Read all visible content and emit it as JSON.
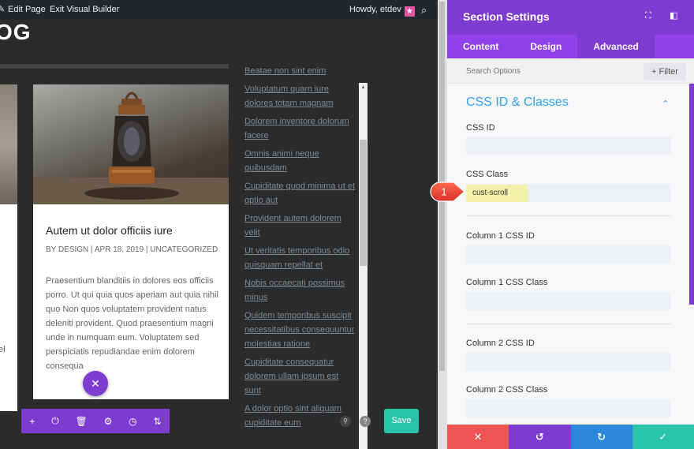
{
  "adminbar": {
    "edit_page": "Edit Page",
    "exit_vb": "Exit Visual Builder",
    "howdy": "Howdy, etdev"
  },
  "canvas": {
    "heading": "OG",
    "post": {
      "title": "Autem ut dolor officiis iure",
      "meta": "BY DESIGN | APR 18, 2019 | UNCATEGORIZED",
      "excerpt": "Praesentium blanditiis in dolores eos officiis porro. Ut qui quia quos aperiam aut quia nihil quo Non quos voluptatem provident natus deleniti provident. Quod praesentium magni unde in numquam eum. Voluptatem sed perspiciatis repudiandae enim dolorem consequa"
    },
    "left_card_text": "el",
    "links": [
      "Beatae non sint enim",
      "Voluptatum quam iure dolores totam magnam",
      "Dolorem inventore dolorum facere",
      "Omnis animi neque quibusdam",
      "Cupiditate quod minima ut et optio aut",
      "Provident autem dolorem velit",
      "Ut veritatis temporibus odio quisquam repellat et",
      "Nobis occaecati possimus minus",
      "Quidem temporibus suscipit necessitatibus consequuntur molestias ratione",
      "Cupiditate consequatur dolorem ullam ipsum est sunt",
      "A dolor optio sint aliquam cupiditate eum"
    ],
    "save_label": "Save"
  },
  "panel": {
    "title": "Section Settings",
    "tabs": [
      "Content",
      "Design",
      "Advanced"
    ],
    "active_tab": "Advanced",
    "search_placeholder": "Search Options",
    "filter_label": "+ Filter",
    "section_title": "CSS ID & Classes",
    "fields": {
      "css_id": "CSS ID",
      "css_class": "CSS Class",
      "css_class_value": "cust-scroll",
      "col1_id": "Column 1 CSS ID",
      "col1_class": "Column 1 CSS Class",
      "col2_id": "Column 2 CSS ID",
      "col2_class": "Column 2 CSS Class"
    },
    "callout_number": "1"
  },
  "colors": {
    "purple": "#7e3bd0",
    "tab_purple": "#8f42ec",
    "teal": "#29c4a9",
    "blue_title": "#2ea3f2",
    "red": "#ef5555",
    "bottom_purple": "#7e3bd0",
    "bottom_blue": "#2b87da",
    "bottom_green": "#29c4a9"
  }
}
